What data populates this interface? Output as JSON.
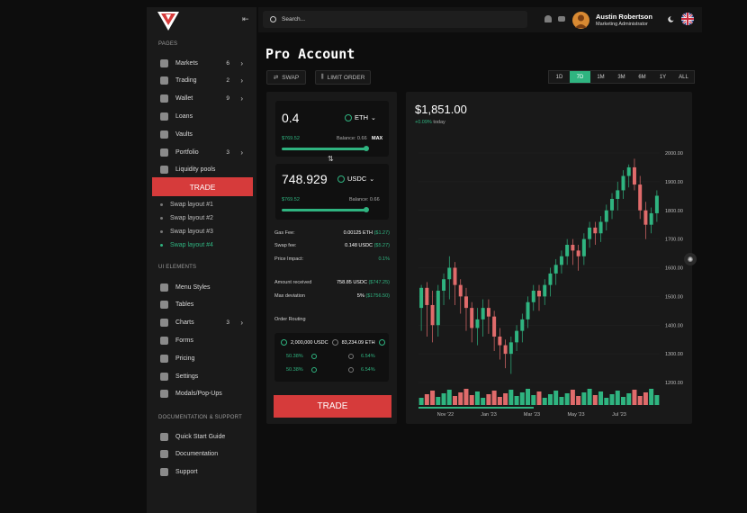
{
  "sidebar": {
    "pages_heading": "PAGES",
    "items": [
      {
        "label": "Markets",
        "count": "6",
        "has_chevron": true,
        "icon": "pie-chart-icon"
      },
      {
        "label": "Trading",
        "count": "2",
        "has_chevron": true,
        "icon": "trading-icon"
      },
      {
        "label": "Wallet",
        "count": "9",
        "has_chevron": true,
        "icon": "wallet-icon"
      },
      {
        "label": "Loans",
        "count": "",
        "has_chevron": false,
        "icon": "loans-icon"
      },
      {
        "label": "Vaults",
        "count": "",
        "has_chevron": false,
        "icon": "shield-icon"
      },
      {
        "label": "Portfolio",
        "count": "3",
        "has_chevron": true,
        "icon": "portfolio-icon"
      },
      {
        "label": "Liquidity pools",
        "count": "",
        "has_chevron": false,
        "icon": "pool-icon"
      }
    ],
    "trade_label": "TRADE",
    "swap_layouts": [
      "Swap layout #1",
      "Swap layout #2",
      "Swap layout #3",
      "Swap layout #4"
    ],
    "active_swap_layout": 3,
    "ui_heading": "UI ELEMENTS",
    "ui_items": [
      {
        "label": "Menu Styles",
        "count": "",
        "has_chevron": false,
        "icon": "menu-icon"
      },
      {
        "label": "Tables",
        "count": "",
        "has_chevron": false,
        "icon": "table-icon"
      },
      {
        "label": "Charts",
        "count": "3",
        "has_chevron": true,
        "icon": "chart-icon"
      },
      {
        "label": "Forms",
        "count": "",
        "has_chevron": false,
        "icon": "form-icon"
      },
      {
        "label": "Pricing",
        "count": "",
        "has_chevron": false,
        "icon": "pricing-icon"
      },
      {
        "label": "Settings",
        "count": "",
        "has_chevron": false,
        "icon": "gear-icon"
      },
      {
        "label": "Modals/Pop-Ups",
        "count": "",
        "has_chevron": false,
        "icon": "modal-icon"
      }
    ],
    "docs_heading": "DOCUMENTATION & SUPPORT",
    "doc_items": [
      {
        "label": "Quick Start Guide",
        "icon": "rocket-icon"
      },
      {
        "label": "Documentation",
        "icon": "book-icon"
      },
      {
        "label": "Support",
        "icon": "support-icon"
      }
    ]
  },
  "header": {
    "search_placeholder": "Search...",
    "user_name": "Austin Robertson",
    "user_role": "Marketing Administrator"
  },
  "page": {
    "title": "Pro Account",
    "swap_label": "SWAP",
    "limit_label": "LIMIT ORDER",
    "ranges": [
      "1D",
      "7D",
      "1M",
      "3M",
      "6M",
      "1Y",
      "ALL"
    ],
    "active_range": "7D"
  },
  "swap": {
    "from_amount": "0.4",
    "from_token": "ETH",
    "from_usd": "$769.52",
    "from_balance": "Balance: 0.66",
    "max_label": "MAX",
    "from_fill": 0.85,
    "to_amount": "748.929",
    "to_token": "USDC",
    "to_usd": "$769.52",
    "to_balance": "Balance: 0.66",
    "to_fill": 0.85,
    "gas_label": "Gas Fee:",
    "gas_value": "0.00125 ETH",
    "gas_usd": "($1.27)",
    "swap_fee_label": "Swap fee:",
    "swap_fee_value": "0.148 USDC",
    "swap_fee_usd": "($5.27)",
    "impact_label": "Price Impact:",
    "impact_value": "0.1%",
    "received_label": "Amount received",
    "received_value": "758.85 USDC",
    "received_usd": "($747.25)",
    "deviation_label": "Max deviation",
    "deviation_value": "5%",
    "deviation_usd": "($1756.50)",
    "routing_label": "Order Routing",
    "route_from": "2,000,000 USDC",
    "route_to": "83,234.09 ETH",
    "route_rows": [
      {
        "left": "50.38%",
        "right": "6.54%"
      },
      {
        "left": "50.38%",
        "right": "6.54%"
      }
    ],
    "trade_label": "TRADE"
  },
  "chart": {
    "price": "$1,851.00",
    "change": "+0.09%",
    "change_suffix": "today",
    "colors": {
      "up": "#2fb480",
      "down": "#e06b6b"
    }
  },
  "chart_data": {
    "type": "candlestick",
    "y_ticks": [
      "2000.00",
      "1900.00",
      "1800.00",
      "1700.00",
      "1600.00",
      "1500.00",
      "1400.00",
      "1300.00",
      "1200.00"
    ],
    "ylim": [
      1200,
      2000
    ],
    "x_ticks": [
      "Nov '22",
      "Jan '23",
      "Mar '23",
      "May '23",
      "Jul '23"
    ],
    "candles": [
      [
        1460,
        1530,
        1400,
        1540,
        1380
      ],
      [
        1530,
        1470,
        1370,
        1550,
        1360
      ],
      [
        1470,
        1400,
        1360,
        1520,
        1340
      ],
      [
        1400,
        1520,
        1360,
        1540,
        1380
      ],
      [
        1520,
        1560,
        1480,
        1580,
        1470
      ],
      [
        1560,
        1600,
        1500,
        1640,
        1490
      ],
      [
        1600,
        1540,
        1500,
        1620,
        1470
      ],
      [
        1540,
        1500,
        1450,
        1560,
        1440
      ],
      [
        1500,
        1460,
        1400,
        1530,
        1380
      ],
      [
        1460,
        1390,
        1350,
        1480,
        1340
      ],
      [
        1390,
        1420,
        1350,
        1460,
        1330
      ],
      [
        1420,
        1460,
        1380,
        1490,
        1360
      ],
      [
        1460,
        1430,
        1380,
        1490,
        1370
      ],
      [
        1430,
        1360,
        1330,
        1450,
        1310
      ],
      [
        1360,
        1330,
        1300,
        1390,
        1280
      ],
      [
        1330,
        1300,
        1270,
        1350,
        1250
      ],
      [
        1300,
        1340,
        1260,
        1360,
        1230
      ],
      [
        1340,
        1380,
        1320,
        1400,
        1310
      ],
      [
        1380,
        1420,
        1360,
        1440,
        1340
      ],
      [
        1420,
        1480,
        1400,
        1500,
        1390
      ],
      [
        1480,
        1520,
        1460,
        1540,
        1450
      ],
      [
        1520,
        1500,
        1460,
        1540,
        1450
      ],
      [
        1500,
        1540,
        1480,
        1560,
        1470
      ],
      [
        1540,
        1580,
        1510,
        1600,
        1500
      ],
      [
        1580,
        1610,
        1560,
        1630,
        1540
      ],
      [
        1610,
        1640,
        1590,
        1660,
        1580
      ],
      [
        1640,
        1680,
        1620,
        1700,
        1610
      ],
      [
        1680,
        1660,
        1620,
        1700,
        1610
      ],
      [
        1660,
        1640,
        1600,
        1680,
        1590
      ],
      [
        1640,
        1700,
        1620,
        1720,
        1610
      ],
      [
        1700,
        1740,
        1680,
        1760,
        1670
      ],
      [
        1740,
        1720,
        1690,
        1760,
        1680
      ],
      [
        1720,
        1760,
        1700,
        1780,
        1690
      ],
      [
        1760,
        1800,
        1740,
        1820,
        1730
      ],
      [
        1800,
        1840,
        1780,
        1860,
        1770
      ],
      [
        1840,
        1870,
        1810,
        1900,
        1800
      ],
      [
        1870,
        1920,
        1850,
        1940,
        1840
      ],
      [
        1920,
        1950,
        1890,
        1960,
        1880
      ],
      [
        1950,
        1890,
        1880,
        1980,
        1870
      ],
      [
        1890,
        1800,
        1790,
        1920,
        1770
      ],
      [
        1800,
        1750,
        1720,
        1830,
        1700
      ],
      [
        1750,
        1790,
        1730,
        1810,
        1720
      ],
      [
        1790,
        1851,
        1770,
        1870,
        1760
      ]
    ],
    "volume_up": [
      1,
      0,
      0,
      1,
      1,
      1,
      0,
      0,
      0,
      0,
      1,
      1,
      0,
      0,
      0,
      0,
      1,
      1,
      1,
      1,
      1,
      0,
      1,
      1,
      1,
      1,
      1,
      0,
      0,
      1,
      1,
      0,
      1,
      1,
      1,
      1,
      1,
      1,
      0,
      0,
      0,
      1,
      1
    ]
  }
}
